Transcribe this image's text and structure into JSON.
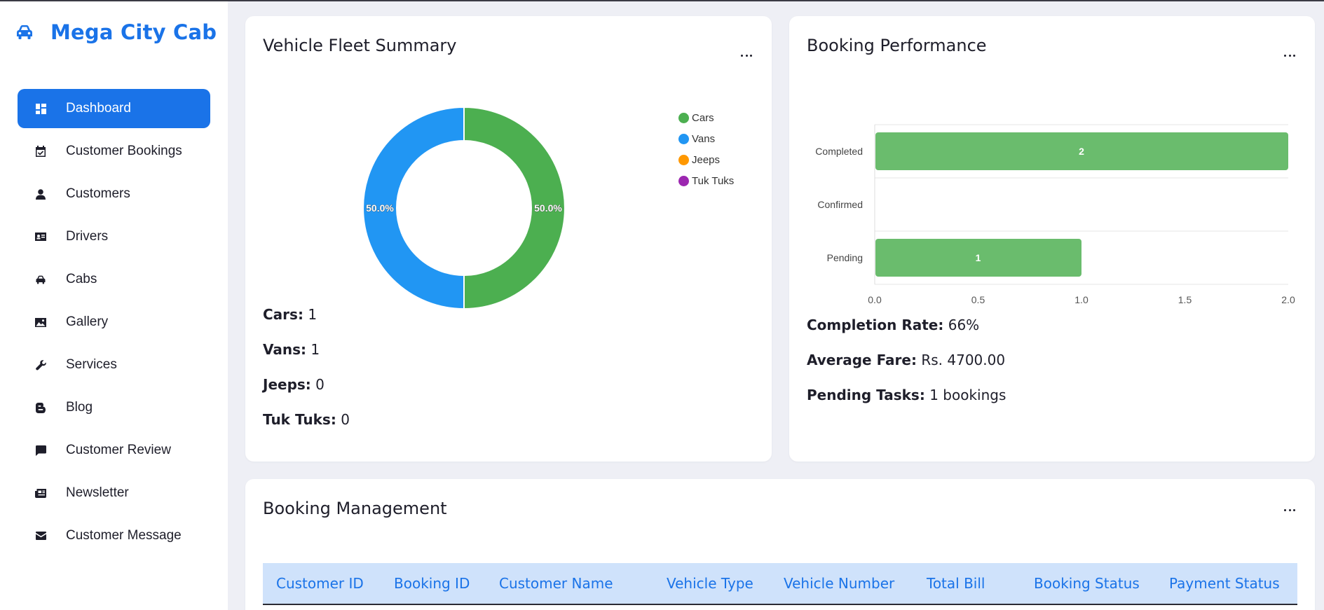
{
  "brand": {
    "title": "Mega City Cab",
    "icon": "car-icon",
    "color": "#1a73e8"
  },
  "nav": [
    {
      "label": "Dashboard",
      "icon": "dashboard-icon",
      "active": true
    },
    {
      "label": "Customer Bookings",
      "icon": "calendar-check-icon"
    },
    {
      "label": "Customers",
      "icon": "user-icon"
    },
    {
      "label": "Drivers",
      "icon": "id-card-icon"
    },
    {
      "label": "Cabs",
      "icon": "car-icon"
    },
    {
      "label": "Gallery",
      "icon": "image-icon"
    },
    {
      "label": "Services",
      "icon": "wrench-icon"
    },
    {
      "label": "Blog",
      "icon": "blogger-icon"
    },
    {
      "label": "Customer Review",
      "icon": "comment-icon"
    },
    {
      "label": "Newsletter",
      "icon": "newspaper-icon"
    },
    {
      "label": "Customer Message",
      "icon": "envelope-icon"
    }
  ],
  "fleet": {
    "title": "Vehicle Fleet Summary",
    "stats": [
      {
        "label": "Cars:",
        "value": "1"
      },
      {
        "label": "Vans:",
        "value": "1"
      },
      {
        "label": "Jeeps:",
        "value": "0"
      },
      {
        "label": "Tuk Tuks:",
        "value": "0"
      }
    ]
  },
  "perf": {
    "title": "Booking Performance",
    "stats": [
      {
        "label": "Completion Rate:",
        "value": "66%"
      },
      {
        "label": "Average Fare:",
        "value": "Rs. 4700.00"
      },
      {
        "label": "Pending Tasks:",
        "value": "1 bookings"
      }
    ]
  },
  "management": {
    "title": "Booking Management",
    "columns": [
      "Customer ID",
      "Booking ID",
      "Customer Name",
      "Vehicle Type",
      "Vehicle Number",
      "Total Bill",
      "Booking Status",
      "Payment Status"
    ]
  },
  "chart_data": [
    {
      "type": "pie",
      "variant": "doughnut",
      "categories": [
        "Cars",
        "Vans",
        "Jeeps",
        "Tuk Tuks"
      ],
      "values": [
        1,
        1,
        0,
        0
      ],
      "slice_labels": [
        "50.0%",
        "50.0%",
        "",
        ""
      ],
      "colors": [
        "#4caf50",
        "#2196f3",
        "#ff9800",
        "#9c27b0"
      ],
      "legend": "right"
    },
    {
      "type": "bar",
      "orientation": "horizontal",
      "categories": [
        "Completed",
        "Confirmed",
        "Pending"
      ],
      "values": [
        2,
        0,
        1
      ],
      "data_labels": [
        "2",
        "",
        "1"
      ],
      "xlim": [
        0,
        2
      ],
      "xticks": [
        "0.0",
        "0.5",
        "1.0",
        "1.5",
        "2.0"
      ],
      "color": "#6abc6d",
      "grid": true
    }
  ]
}
